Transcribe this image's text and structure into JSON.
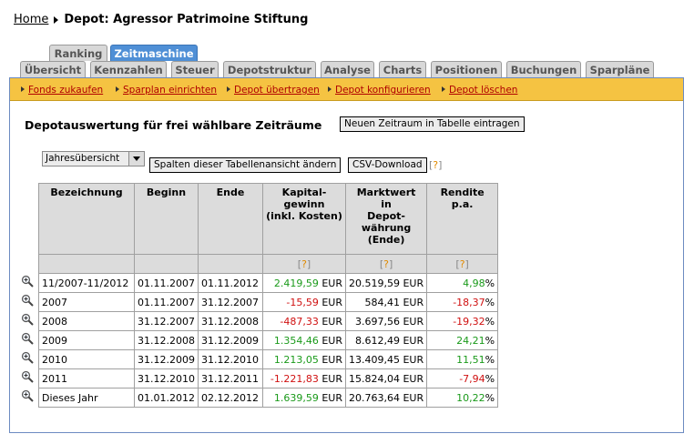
{
  "breadcrumb": {
    "home": "Home",
    "title": "Depot: Agressor Patrimoine Stiftung"
  },
  "tabs_top": [
    "Ranking",
    "Zeitmaschine"
  ],
  "tabs_bottom": [
    "Übersicht",
    "Kennzahlen",
    "Steuer",
    "Depotstruktur",
    "Analyse",
    "Charts",
    "Positionen",
    "Buchungen",
    "Sparpläne"
  ],
  "actions": [
    "Fonds zukaufen",
    "Sparplan einrichten",
    "Depot übertragen",
    "Depot konfigurieren",
    "Depot löschen"
  ],
  "section": {
    "title": "Depotauswertung für frei wählbare Zeiträume",
    "new_period_button": "Neuen Zeitraum in Tabelle eintragen",
    "view_select": "Jahresübersicht",
    "change_columns_button": "Spalten dieser Tabellenansicht ändern",
    "csv_button": "CSV-Download",
    "help": "?"
  },
  "table": {
    "headers": [
      "Bezeichnung",
      "Beginn",
      "Ende",
      "Kapital-\ngewinn\n(inkl. Kosten)",
      "Marktwert\nin\nDepot-\nwährung\n(Ende)",
      "Rendite p.a."
    ],
    "rows": [
      {
        "name": "11/2007-11/2012",
        "begin": "01.11.2007",
        "end": "01.11.2012",
        "gain": "2.419,59",
        "value": "20.519,59",
        "ret": "4,98",
        "sign": "pos"
      },
      {
        "name": "2007",
        "begin": "01.11.2007",
        "end": "31.12.2007",
        "gain": "-15,59",
        "value": "584,41",
        "ret": "-18,37",
        "sign": "neg"
      },
      {
        "name": "2008",
        "begin": "31.12.2007",
        "end": "31.12.2008",
        "gain": "-487,33",
        "value": "3.697,56",
        "ret": "-19,32",
        "sign": "neg"
      },
      {
        "name": "2009",
        "begin": "31.12.2008",
        "end": "31.12.2009",
        "gain": "1.354,46",
        "value": "8.612,49",
        "ret": "24,21",
        "sign": "pos"
      },
      {
        "name": "2010",
        "begin": "31.12.2009",
        "end": "31.12.2010",
        "gain": "1.213,05",
        "value": "13.409,45",
        "ret": "11,51",
        "sign": "pos"
      },
      {
        "name": "2011",
        "begin": "31.12.2010",
        "end": "31.12.2011",
        "gain": "-1.221,83",
        "value": "15.824,04",
        "ret": "-7,94",
        "sign": "neg"
      },
      {
        "name": "Dieses Jahr",
        "begin": "01.01.2012",
        "end": "02.12.2012",
        "gain": "1.639,59",
        "value": "20.763,64",
        "ret": "10,22",
        "sign": "pos"
      }
    ],
    "currency": "EUR",
    "percent": "%"
  },
  "colors": {
    "positive": "#1a9a1a",
    "negative": "#d01010",
    "action_bar": "#f5c342",
    "active_tab": "#4f8fd6"
  }
}
